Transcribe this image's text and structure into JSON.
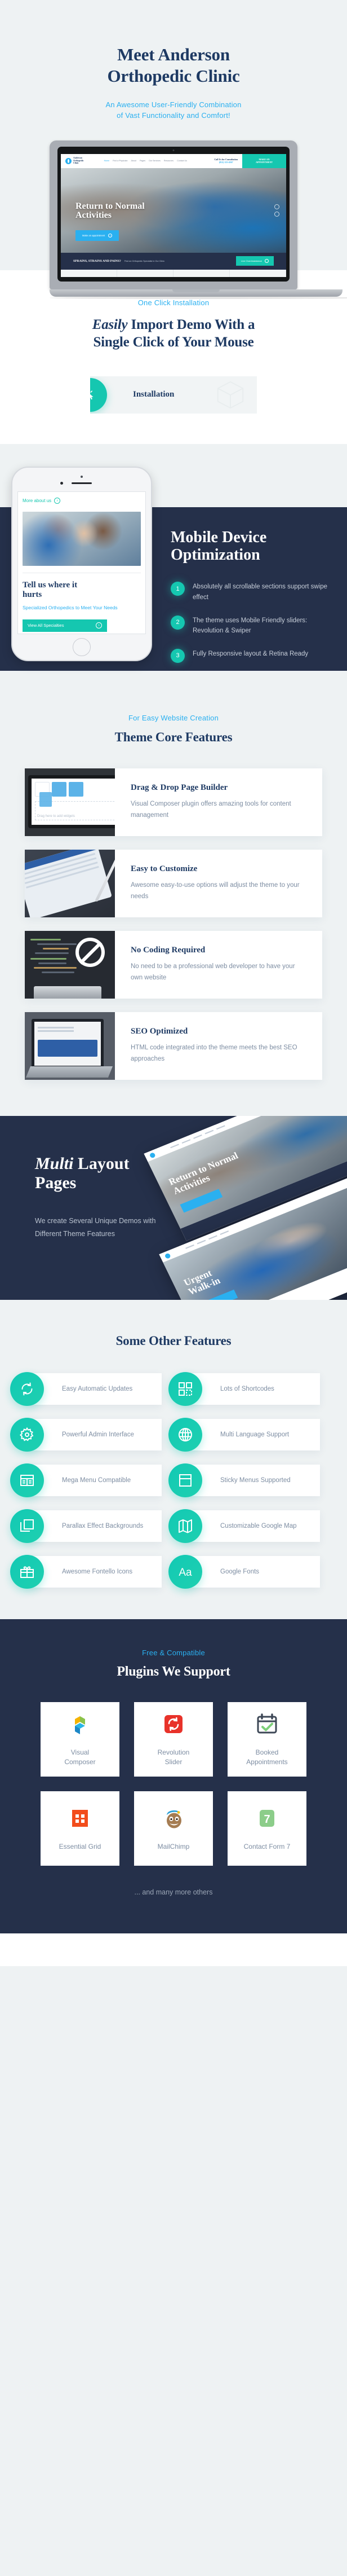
{
  "hero": {
    "title_line1": "Meet Anderson",
    "title_line2": "Orthopedic Clinic",
    "subtitle_line1": "An Awesome User-Friendly Combination",
    "subtitle_line2": "of Vast Functionality  and Comfort!",
    "accent": "#2ab0f0"
  },
  "laptop_site": {
    "logo_line1": "Anderson",
    "logo_line2": "Orthopedic",
    "logo_line3": "Clinic",
    "nav": [
      "Home",
      "Find a Physician",
      "About",
      "Pages",
      "Our Services",
      "Resources",
      "Contact Us"
    ],
    "phone_label": "Call Us for Consultation",
    "phone_number": "(812) 123-4567",
    "header_cta_line1": "MAKE AN",
    "header_cta_line2": "APPOINTMENT",
    "hero_title_line1": "Return to Normal",
    "hero_title_line2": "Activities",
    "hero_button": "Make an appointment",
    "band_bold": "SPRAINS, STRAINS AND PAINS?",
    "band_text": "Find an Orthopedic Specialist in Our Clinic",
    "band_button": "Live Chat Assistance"
  },
  "installation": {
    "eyebrow": "One Click Installation",
    "title_italic": "Easily",
    "title_rest": " Import Demo With a",
    "title_line2": "Single Click of Your Mouse",
    "badge_icon": "click-cursor-icon",
    "label": "Installation"
  },
  "mobile": {
    "title_line1": "Mobile Device",
    "title_line2": "Optimization",
    "items": [
      {
        "num": "1",
        "text": "Absolutely all scrollable sections support swipe effect"
      },
      {
        "num": "2",
        "text": "The theme uses Mobile Friendly sliders: Revolution & Swiper"
      },
      {
        "num": "3",
        "text": "Fully Responsive layout & Retina Ready"
      }
    ],
    "phone_screen": {
      "link": "More about us",
      "heading_line1": "Tell us where it",
      "heading_line2": "hurts",
      "paragraph": "Specialized Orthopedics to Meet Your Needs",
      "button": "View All Specialties"
    }
  },
  "core": {
    "eyebrow": "For Easy Website Creation",
    "title": "Theme Core Features",
    "cards": [
      {
        "title": "Drag & Drop Page Builder",
        "text": "Visual  Composer plugin offers amazing tools for content management",
        "art": "builder"
      },
      {
        "title": "Easy to Customize",
        "text": "Awesome easy-to-use options will adjust the theme to your needs",
        "art": "custom"
      },
      {
        "title": "No Coding Required",
        "text": "No need to be a professional web developer to have your own website",
        "art": "code"
      },
      {
        "title": "SEO Optimized",
        "text": "HTML code integrated into the theme meets the best SEO approaches",
        "art": "seo"
      }
    ]
  },
  "multi": {
    "title_italic": "Multi",
    "title_rest": " Layout",
    "title_line2": "Pages",
    "paragraph": "We create Several Unique Demos with Different Theme Features"
  },
  "other": {
    "title": "Some Other Features",
    "items": [
      {
        "label": "Easy Automatic Updates",
        "icon": "refresh-icon"
      },
      {
        "label": "Lots of Shortcodes",
        "icon": "shortcodes-grid-icon"
      },
      {
        "label": "Powerful Admin Interface",
        "icon": "gear-icon"
      },
      {
        "label": "Multi Language Support",
        "icon": "globe-icon"
      },
      {
        "label": "Mega Menu Compatible",
        "icon": "mega-menu-icon"
      },
      {
        "label": "Sticky Menus Supported",
        "icon": "sticky-menu-icon"
      },
      {
        "label": "Parallax Effect Backgrounds",
        "icon": "layers-icon"
      },
      {
        "label": "Customizable Google Map",
        "icon": "map-icon"
      },
      {
        "label": "Awesome Fontello Icons",
        "icon": "gift-icon"
      },
      {
        "label": "Google Fonts",
        "icon": "typography-aa-icon"
      }
    ]
  },
  "plugins": {
    "eyebrow": "Free & Compatible",
    "title": "Plugins We Support",
    "items": [
      {
        "name_line1": "Visual",
        "name_line2": "Composer",
        "icon": "visual-composer-logo"
      },
      {
        "name_line1": "Revolution",
        "name_line2": "Slider",
        "icon": "revolution-slider-logo"
      },
      {
        "name_line1": "Booked",
        "name_line2": "Appointments",
        "icon": "booked-appointments-logo"
      },
      {
        "name_line1": "Essential Grid",
        "name_line2": "",
        "icon": "essential-grid-logo"
      },
      {
        "name_line1": "MailChimp",
        "name_line2": "",
        "icon": "mailchimp-logo"
      },
      {
        "name_line1": "Contact Form 7",
        "name_line2": "",
        "icon": "contact-form-7-logo"
      }
    ],
    "footnote": "... and many more others"
  },
  "colors": {
    "page_bg": "#eef2f3",
    "dark": "#25304a",
    "navy": "#1e3a63",
    "blue": "#2ab0f0",
    "teal": "#15c7b0",
    "muted": "#7d8da2"
  }
}
